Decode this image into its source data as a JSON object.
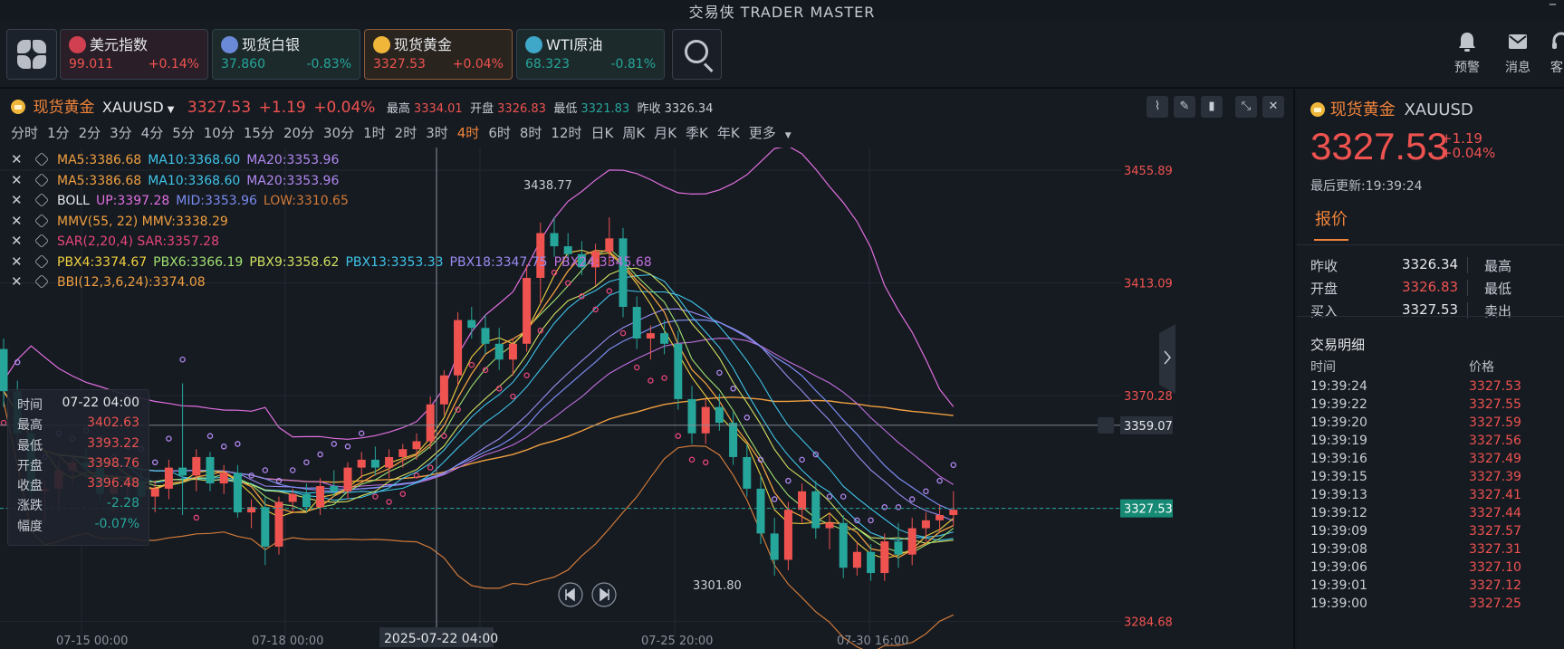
{
  "app": {
    "title": "交易侠  TRADER MASTER",
    "minimize_icon": "minimize-icon"
  },
  "colors": {
    "up": "#ef5350",
    "down": "#26a69a",
    "accent": "#f0843a",
    "gold": "#f0b63a"
  },
  "tickers": [
    {
      "name": "美元指数",
      "price": "99.011",
      "change": "+0.14%",
      "dir": "up",
      "icon": "us-flag-icon"
    },
    {
      "name": "现货白银",
      "price": "37.860",
      "change": "-0.83%",
      "dir": "down",
      "icon": "silver-icon"
    },
    {
      "name": "现货黄金",
      "price": "3327.53",
      "change": "+0.04%",
      "dir": "up",
      "icon": "gold-icon",
      "selected": true
    },
    {
      "name": "WTI原油",
      "price": "68.323",
      "change": "-0.81%",
      "dir": "down",
      "icon": "oil-icon"
    }
  ],
  "toolbar": {
    "alert": "预警",
    "messages": "消息",
    "service": "客"
  },
  "symbol": {
    "name": "现货黄金",
    "code": "XAUUSD",
    "price": "3327.53",
    "change": "+1.19",
    "change_pct": "+0.04%",
    "high_label": "最高",
    "high": "3334.01",
    "open_label": "开盘",
    "open": "3326.83",
    "low_label": "最低",
    "low": "3321.83",
    "prev_label": "昨收",
    "prev": "3326.34"
  },
  "intervals": [
    "分时",
    "1分",
    "2分",
    "3分",
    "4分",
    "5分",
    "10分",
    "15分",
    "20分",
    "30分",
    "1时",
    "2时",
    "3时",
    "4时",
    "6时",
    "8时",
    "12时",
    "日K",
    "周K",
    "月K",
    "季K",
    "年K",
    "更多"
  ],
  "active_interval": "4时",
  "indicators": [
    {
      "parts": [
        {
          "t": "MA5:3386.68",
          "c": "#f0a040"
        },
        {
          "t": "MA10:3368.60",
          "c": "#3fc4e8"
        },
        {
          "t": "MA20:3353.96",
          "c": "#b088f0"
        }
      ]
    },
    {
      "parts": [
        {
          "t": "MA5:3386.68",
          "c": "#f0a040"
        },
        {
          "t": "MA10:3368.60",
          "c": "#3fc4e8"
        },
        {
          "t": "MA20:3353.96",
          "c": "#b088f0"
        }
      ]
    },
    {
      "parts": [
        {
          "t": "BOLL",
          "c": "#e6e8ea"
        },
        {
          "t": "UP:3397.28",
          "c": "#e070e0"
        },
        {
          "t": "MID:3353.96",
          "c": "#7a8cf0"
        },
        {
          "t": "LOW:3310.65",
          "c": "#d07a3a"
        }
      ]
    },
    {
      "parts": [
        {
          "t": "MMV(55, 22) MMV:3338.29",
          "c": "#f0a040"
        }
      ]
    },
    {
      "parts": [
        {
          "t": "SAR(2,20,4) SAR:3357.28",
          "c": "#e8467a"
        }
      ]
    },
    {
      "parts": [
        {
          "t": "PBX4:3374.67",
          "c": "#f0d040"
        },
        {
          "t": "PBX6:3366.19",
          "c": "#a0e070"
        },
        {
          "t": "PBX9:3358.62",
          "c": "#d0e060"
        },
        {
          "t": "PBX13:3353.33",
          "c": "#3fc4e8"
        },
        {
          "t": "PBX18:3347.75",
          "c": "#9a8cf0"
        },
        {
          "t": "PBX24:3345.68",
          "c": "#c070e0"
        }
      ]
    },
    {
      "parts": [
        {
          "t": "BBI(12,3,6,24):3374.08",
          "c": "#f0a040"
        }
      ]
    }
  ],
  "ohlc_box": [
    {
      "k": "时间",
      "v": "07-22 04:00",
      "c": "#e6e8ea"
    },
    {
      "k": "最高",
      "v": "3402.63",
      "c": "#ef5350"
    },
    {
      "k": "最低",
      "v": "3393.22",
      "c": "#ef5350"
    },
    {
      "k": "开盘",
      "v": "3398.76",
      "c": "#ef5350"
    },
    {
      "k": "收盘",
      "v": "3396.48",
      "c": "#ef5350"
    },
    {
      "k": "涨跌",
      "v": "-2.28",
      "c": "#26a69a"
    },
    {
      "k": "幅度",
      "v": "-0.07%",
      "c": "#26a69a"
    }
  ],
  "chart_data": {
    "type": "candlestick",
    "y_ticks": [
      "3455.89",
      "3413.09",
      "3370.28",
      "3284.68"
    ],
    "x_ticks": [
      "07-15 00:00",
      "07-18 00:00",
      "07-25 20:00",
      "07-30 16:00"
    ],
    "crosshair_x_label": "2025-07-22 04:00",
    "crosshair_y_label": "3359.07",
    "last_price_label": "3327.53",
    "max_label": "3438.77",
    "min_label": "3301.80",
    "ylim": [
      3280,
      3460
    ],
    "candles": [
      [
        3388,
        3392,
        3366,
        3372
      ],
      [
        3372,
        3376,
        3352,
        3356
      ],
      [
        3356,
        3360,
        3330,
        3334
      ],
      [
        3334,
        3338,
        3322,
        3335
      ],
      [
        3335,
        3346,
        3328,
        3342
      ],
      [
        3342,
        3348,
        3336,
        3345
      ],
      [
        3345,
        3350,
        3339,
        3343
      ],
      [
        3343,
        3346,
        3330,
        3333
      ],
      [
        3333,
        3338,
        3326,
        3336
      ],
      [
        3336,
        3341,
        3332,
        3338
      ],
      [
        3338,
        3344,
        3330,
        3332
      ],
      [
        3332,
        3338,
        3326,
        3335
      ],
      [
        3335,
        3346,
        3331,
        3343
      ],
      [
        3343,
        3375,
        3325,
        3340
      ],
      [
        3340,
        3350,
        3334,
        3347
      ],
      [
        3347,
        3349,
        3334,
        3337
      ],
      [
        3337,
        3344,
        3333,
        3341
      ],
      [
        3341,
        3344,
        3324,
        3326
      ],
      [
        3326,
        3331,
        3320,
        3328
      ],
      [
        3328,
        3332,
        3306,
        3313
      ],
      [
        3313,
        3332,
        3310,
        3330
      ],
      [
        3330,
        3335,
        3326,
        3333
      ],
      [
        3333,
        3337,
        3326,
        3328
      ],
      [
        3328,
        3339,
        3325,
        3336
      ],
      [
        3336,
        3342,
        3332,
        3334
      ],
      [
        3334,
        3345,
        3331,
        3343
      ],
      [
        3343,
        3349,
        3339,
        3346
      ],
      [
        3346,
        3351,
        3340,
        3343
      ],
      [
        3343,
        3350,
        3339,
        3347
      ],
      [
        3347,
        3352,
        3343,
        3350
      ],
      [
        3350,
        3356,
        3346,
        3353
      ],
      [
        3353,
        3370,
        3350,
        3367
      ],
      [
        3367,
        3380,
        3363,
        3378
      ],
      [
        3378,
        3402,
        3374,
        3399
      ],
      [
        3399,
        3404,
        3392,
        3396
      ],
      [
        3396,
        3401,
        3386,
        3390
      ],
      [
        3390,
        3396,
        3380,
        3384
      ],
      [
        3384,
        3392,
        3378,
        3390
      ],
      [
        3390,
        3420,
        3387,
        3415
      ],
      [
        3415,
        3436,
        3405,
        3432
      ],
      [
        3432,
        3438,
        3423,
        3427
      ],
      [
        3427,
        3432,
        3420,
        3424
      ],
      [
        3424,
        3429,
        3416,
        3419
      ],
      [
        3419,
        3428,
        3412,
        3425
      ],
      [
        3425,
        3438,
        3420,
        3430
      ],
      [
        3430,
        3434,
        3400,
        3404
      ],
      [
        3404,
        3408,
        3388,
        3392
      ],
      [
        3392,
        3397,
        3384,
        3394
      ],
      [
        3394,
        3399,
        3386,
        3390
      ],
      [
        3390,
        3395,
        3365,
        3369
      ],
      [
        3369,
        3374,
        3352,
        3356
      ],
      [
        3356,
        3369,
        3352,
        3366
      ],
      [
        3366,
        3371,
        3357,
        3360
      ],
      [
        3360,
        3364,
        3344,
        3347
      ],
      [
        3347,
        3352,
        3332,
        3335
      ],
      [
        3335,
        3340,
        3314,
        3318
      ],
      [
        3318,
        3324,
        3302,
        3308
      ],
      [
        3308,
        3330,
        3304,
        3327
      ],
      [
        3327,
        3337,
        3322,
        3334
      ],
      [
        3334,
        3338,
        3316,
        3320
      ],
      [
        3320,
        3326,
        3312,
        3322
      ],
      [
        3322,
        3325,
        3301,
        3305
      ],
      [
        3305,
        3315,
        3302,
        3311
      ],
      [
        3311,
        3314,
        3300,
        3303
      ],
      [
        3303,
        3318,
        3300,
        3315
      ],
      [
        3315,
        3322,
        3305,
        3310
      ],
      [
        3310,
        3324,
        3306,
        3320
      ],
      [
        3320,
        3326,
        3315,
        3323
      ],
      [
        3323,
        3329,
        3319,
        3325
      ],
      [
        3325,
        3334,
        3321,
        3327
      ]
    ]
  },
  "right_panel": {
    "name": "现货黄金",
    "code": "XAUUSD",
    "price": "3327.53",
    "change": "+1.19",
    "change_pct": "+0.04%",
    "updated": "最后更新:19:39:24",
    "tab": "报价",
    "quote": [
      {
        "l": "昨收",
        "v": "3326.34",
        "c": "#e6e8ea",
        "l2": "最高"
      },
      {
        "l": "开盘",
        "v": "3326.83",
        "c": "#ef5350",
        "l2": "最低"
      },
      {
        "l": "买入",
        "v": "3327.53",
        "c": "#e6e8ea",
        "l2": "卖出"
      }
    ],
    "trades_title": "交易明细",
    "col_time": "时间",
    "col_price": "价格",
    "trades": [
      [
        "19:39:24",
        "3327.53"
      ],
      [
        "19:39:22",
        "3327.55"
      ],
      [
        "19:39:20",
        "3327.59"
      ],
      [
        "19:39:19",
        "3327.56"
      ],
      [
        "19:39:16",
        "3327.49"
      ],
      [
        "19:39:15",
        "3327.39"
      ],
      [
        "19:39:13",
        "3327.41"
      ],
      [
        "19:39:12",
        "3327.44"
      ],
      [
        "19:39:09",
        "3327.57"
      ],
      [
        "19:39:08",
        "3327.31"
      ],
      [
        "19:39:06",
        "3327.10"
      ],
      [
        "19:39:01",
        "3327.12"
      ],
      [
        "19:39:00",
        "3327.25"
      ]
    ]
  }
}
